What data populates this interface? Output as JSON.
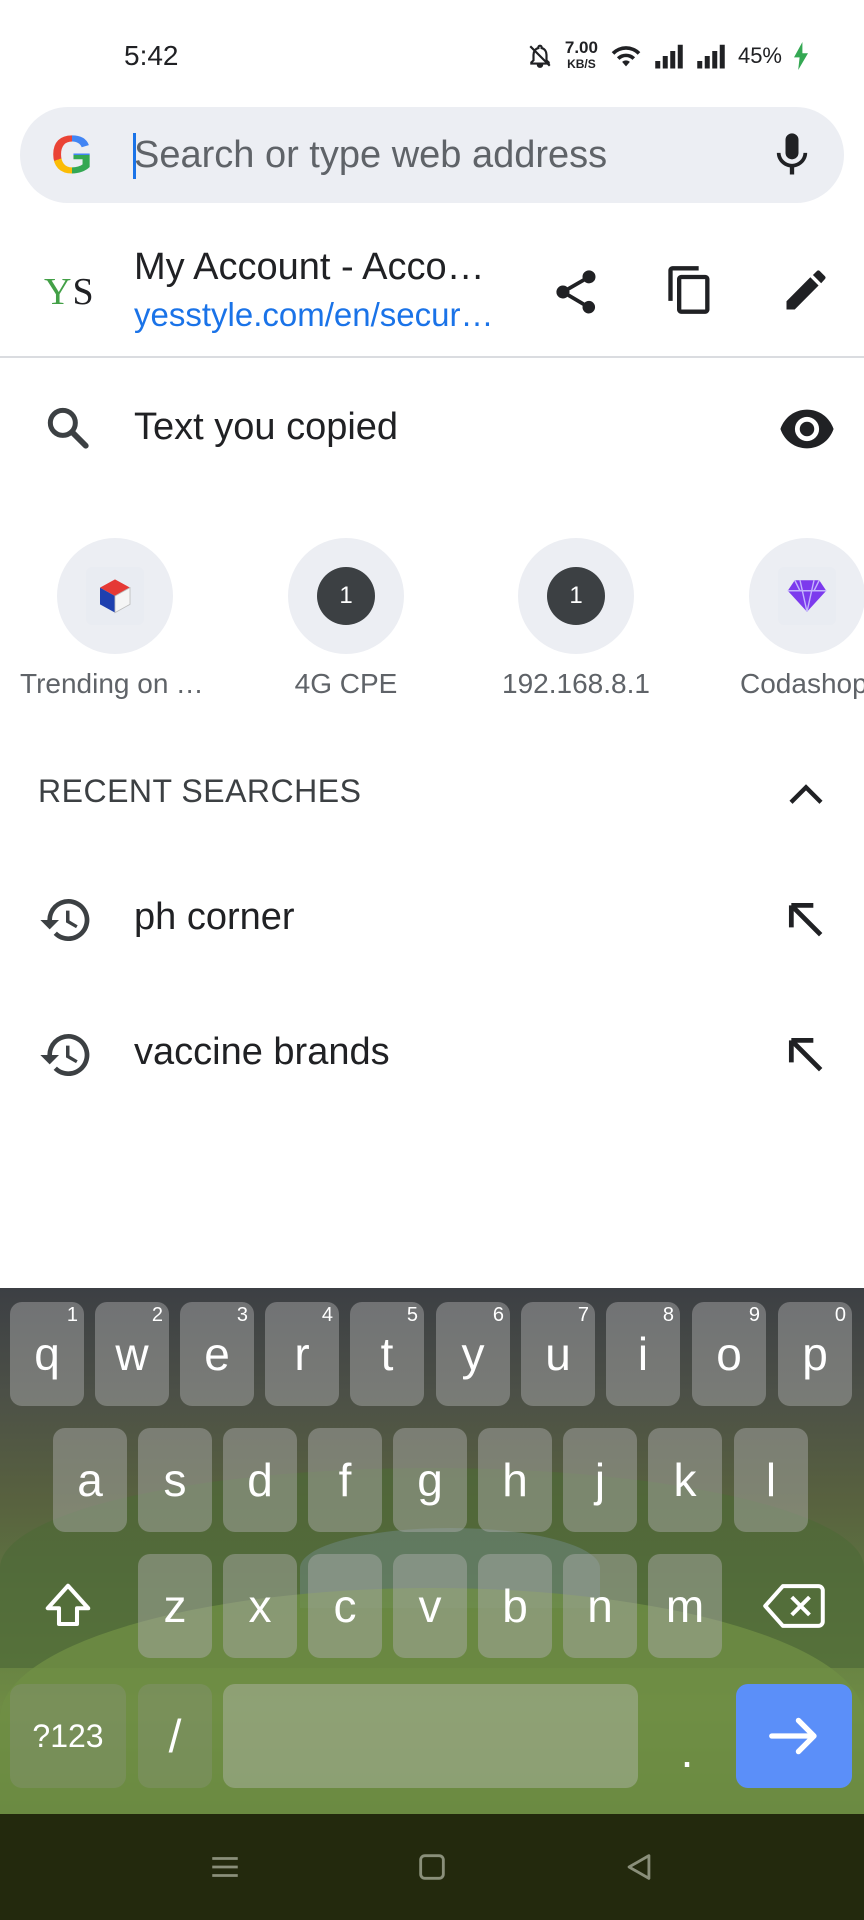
{
  "status_bar": {
    "time": "5:42",
    "net_speed_value": "7.00",
    "net_speed_unit": "KB/S",
    "battery": "45%",
    "icons": [
      "mute-bell-icon",
      "wifi-icon",
      "signal-icon",
      "signal-icon",
      "charging-bolt-icon"
    ]
  },
  "omnibox": {
    "logo_letter": "G",
    "placeholder": "Search or type web address",
    "value": ""
  },
  "current_page": {
    "favicon_letters": [
      "Y",
      "S"
    ],
    "title": "My Account - Account Security",
    "url": "yesstyle.com/en/secure/myaccount"
  },
  "clipboard": {
    "label": "Text you copied"
  },
  "shortcuts": [
    {
      "label": "Trending on YesStyle",
      "icon": "yesstyle-cube-icon",
      "badge": ""
    },
    {
      "label": "4G CPE",
      "icon": "number-badge",
      "badge": "1"
    },
    {
      "label": "192.168.8.1",
      "icon": "number-badge",
      "badge": "1"
    },
    {
      "label": "Codashop",
      "icon": "codashop-gem-icon",
      "badge": ""
    }
  ],
  "recent": {
    "header": "RECENT SEARCHES",
    "items": [
      {
        "text": "ph corner"
      },
      {
        "text": "vaccine brands"
      }
    ]
  },
  "keyboard": {
    "row1": [
      {
        "key": "q",
        "hint": "1"
      },
      {
        "key": "w",
        "hint": "2"
      },
      {
        "key": "e",
        "hint": "3"
      },
      {
        "key": "r",
        "hint": "4"
      },
      {
        "key": "t",
        "hint": "5"
      },
      {
        "key": "y",
        "hint": "6"
      },
      {
        "key": "u",
        "hint": "7"
      },
      {
        "key": "i",
        "hint": "8"
      },
      {
        "key": "o",
        "hint": "9"
      },
      {
        "key": "p",
        "hint": "0"
      }
    ],
    "row2": [
      "a",
      "s",
      "d",
      "f",
      "g",
      "h",
      "j",
      "k",
      "l"
    ],
    "row3": [
      "z",
      "x",
      "c",
      "v",
      "b",
      "n",
      "m"
    ],
    "symbols_label": "?123",
    "slash_label": "/",
    "period_label": ".",
    "accent_color": "#5b8ff9"
  }
}
